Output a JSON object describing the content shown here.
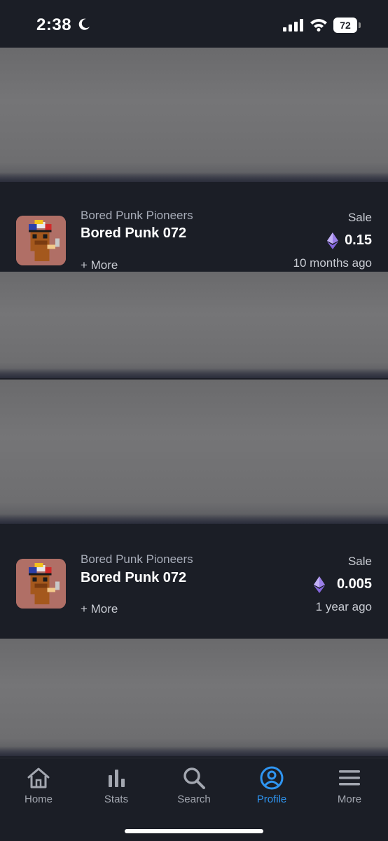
{
  "status_bar": {
    "time": "2:38",
    "battery": "72"
  },
  "activities": [
    {
      "collection": "Bored Punk Pioneers",
      "name": "Bored Punk 072",
      "more": "+ More",
      "type": "Sale",
      "price": "0.15",
      "time_ago": "10 months ago"
    },
    {
      "collection": "Bored Punk Pioneers",
      "name": "Bored Punk 072",
      "more": "+ More",
      "type": "Sale",
      "price": "0.005",
      "time_ago": "1 year ago"
    }
  ],
  "tabs": [
    {
      "label": "Home",
      "icon": "home-icon"
    },
    {
      "label": "Stats",
      "icon": "stats-icon"
    },
    {
      "label": "Search",
      "icon": "search-icon"
    },
    {
      "label": "Profile",
      "icon": "profile-icon"
    },
    {
      "label": "More",
      "icon": "menu-icon"
    }
  ],
  "active_tab": "Profile",
  "colors": {
    "background": "#1b1e26",
    "accent": "#2f95f1",
    "eth": "#9b7fe8",
    "thumbnail": "#b06f66"
  }
}
